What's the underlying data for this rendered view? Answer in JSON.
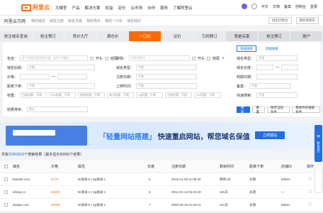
{
  "topbar": {
    "logo_text": "阿里云",
    "nav": [
      "大模型",
      "产品",
      "解决方案",
      "权益",
      "定价",
      "云市场",
      "伙伴",
      "服务",
      "了解阿里云"
    ],
    "right": [
      "中文",
      "文档",
      "备案",
      "控制台",
      "登录"
    ]
  },
  "subbar": {
    "title": "阿里云万网",
    "crumbs": [
      "我的域名",
      "域名注册",
      "域名交易",
      "我的竞价",
      "我的一口价",
      "域名经纪"
    ],
    "right": [
      "域名控制台",
      "我的购物车"
    ]
  },
  "tabs": {
    "items": [
      "抢注域名查询",
      "抢注预订",
      "竞价大厅",
      "满仓价",
      "一口价",
      "议价",
      "万网预订",
      "我是买家",
      "抢注预订",
      "账户"
    ],
    "active_index": 4
  },
  "filter": {
    "basic_search": "基础搜索",
    "advanced_search": "高级搜索",
    "keyword_label": "包含：",
    "keyword_placeholder": "多个关键词用空格分隔，支持*号通配",
    "start_label": "开头",
    "end_label": "结尾",
    "exclude_label": "排除：",
    "exclude_placeholder": "排除关键词",
    "domain_suffix_label": "域名后缀：",
    "domain_suffix_value": "不限",
    "domain_type_label": "域名类型：",
    "domain_type_value": "不限",
    "domain_len_label": "域名长度：",
    "price_label": "价格：",
    "reg_date_label": "注册日期：",
    "reg_date_value": "不限",
    "expire_label": "到期日期：",
    "days_left_label": "距离下架：",
    "days_left_value": "不限",
    "create_date_label": "上架时间：",
    "create_date_value": "不限",
    "cert_label": "备案：",
    "cert_value": "不限",
    "weight_label": "权重：",
    "weight_options": [
      "百度权重：不限",
      "360权重：不限",
      "搜狗权重：不限",
      "神马权重：不限",
      "Sg权重：不限",
      "谷歌权重：不限",
      "Sm权重：不限"
    ],
    "fast_search_label": "快速搜索：",
    "fast_search_value": "不限",
    "sort_label": "结果排序：",
    "sort_value": "默认",
    "search_button": "搜索",
    "reset_button": "重置",
    "save_button": "保存当前条件",
    "saved_button": "我保存的搜索条件"
  },
  "banner": {
    "tag": "www",
    "text_quote": "「轻量网站搭建」",
    "text_rest": "快速重启网站，帮您域名保值",
    "cta": "立即建站"
  },
  "count": {
    "prefix": "共有",
    "number": "20303553",
    "suffix": "个搜索结果（最多显示30000个结果）"
  },
  "table": {
    "headers": [
      "域名",
      "价格",
      "属性",
      "长度",
      "注册日期",
      "剩余时间",
      "距离下架",
      "店铺ID",
      "操作"
    ],
    "rows": [
      {
        "domain": "baiadai.com",
        "price": "¥179",
        "attr": "Br收录:0 | Sg收录:1",
        "len": "6",
        "reg": "2015-12-08 11:09:30",
        "left": "剩余1天",
        "offline": "长期",
        "shop": "56601"
      },
      {
        "domain": "lvfang.cn",
        "price": "¥1800",
        "attr": "Br收录:1 | Sg收录:1",
        "len": "6",
        "reg": "2012-01-13 04:03:20",
        "left": "315天",
        "offline": "长期",
        "shop": "—"
      },
      {
        "domain": "laiaqie.com",
        "price": "¥8780",
        "attr": "Br收录:0 | Sg收录:1",
        "len": "7",
        "reg": "2000-09-18 21:29:11",
        "left": "231天",
        "offline": "长期",
        "shop": "56601"
      }
    ]
  },
  "side_float": {
    "label": "联系我们"
  },
  "colors": {
    "brand": "#ff6a00",
    "blue": "#1e6fe8"
  }
}
